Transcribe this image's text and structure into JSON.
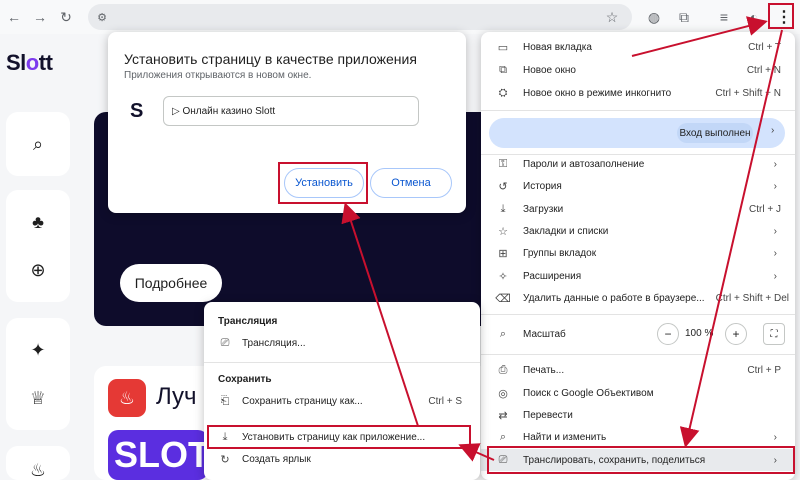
{
  "page": {
    "logo_text": "Sl",
    "logo_dot": "o",
    "logo_rest": "tt",
    "more_button": "Подробнее",
    "section_title": "Луч",
    "tile_text": "SLOT"
  },
  "install_dialog": {
    "title": "Установить страницу в качестве приложения",
    "subtitle": "Приложения открываются в новом окне.",
    "app_icon_letter": "S",
    "app_name_value": "▷ Онлайн казино Slott",
    "install_button": "Установить",
    "cancel_button": "Отмена"
  },
  "menu": {
    "items": [
      {
        "label": "Новая вкладка",
        "shortcut": "Ctrl + T",
        "icon": "new-tab-icon"
      },
      {
        "label": "Новое окно",
        "shortcut": "Ctrl + N",
        "icon": "new-window-icon"
      },
      {
        "label": "Новое окно в режиме инкогнито",
        "shortcut": "Ctrl + Shift + N",
        "icon": "incognito-icon"
      }
    ],
    "profile_status": "Вход выполнен",
    "items2": [
      {
        "label": "Пароли и автозаполнение",
        "icon": "key-icon"
      },
      {
        "label": "История",
        "icon": "history-icon"
      },
      {
        "label": "Загрузки",
        "shortcut": "Ctrl + J",
        "icon": "download-icon"
      },
      {
        "label": "Закладки и списки",
        "icon": "star-icon"
      },
      {
        "label": "Группы вкладок",
        "icon": "tab-groups-icon"
      },
      {
        "label": "Расширения",
        "icon": "puzzle-icon"
      },
      {
        "label": "Удалить данные о работе в браузере...",
        "shortcut": "Ctrl + Shift + Del",
        "icon": "trash-icon"
      }
    ],
    "zoom_label": "Масштаб",
    "zoom_value": "100 %",
    "zoom_minus": "−",
    "zoom_plus": "+",
    "items3": [
      {
        "label": "Печать...",
        "shortcut": "Ctrl + P",
        "icon": "print-icon"
      },
      {
        "label": "Поиск с Google Объективом",
        "icon": "lens-icon"
      },
      {
        "label": "Перевести",
        "icon": "translate-icon"
      },
      {
        "label": "Найти и изменить",
        "icon": "find-icon"
      },
      {
        "label": "Транслировать, сохранить, поделиться",
        "icon": "cast-icon"
      }
    ]
  },
  "submenu": {
    "header_cast": "Трансляция",
    "cast_item": "Трансляция...",
    "header_save": "Сохранить",
    "save_item": "Сохранить страницу как...",
    "save_shortcut": "Ctrl + S",
    "install_item": "Установить страницу как приложение...",
    "shortcut_item": "Создать ярлык"
  },
  "colors": {
    "annotation_red": "#c8102e",
    "accent_blue": "#0b57d0",
    "banner_dark": "#0e0c2b"
  }
}
